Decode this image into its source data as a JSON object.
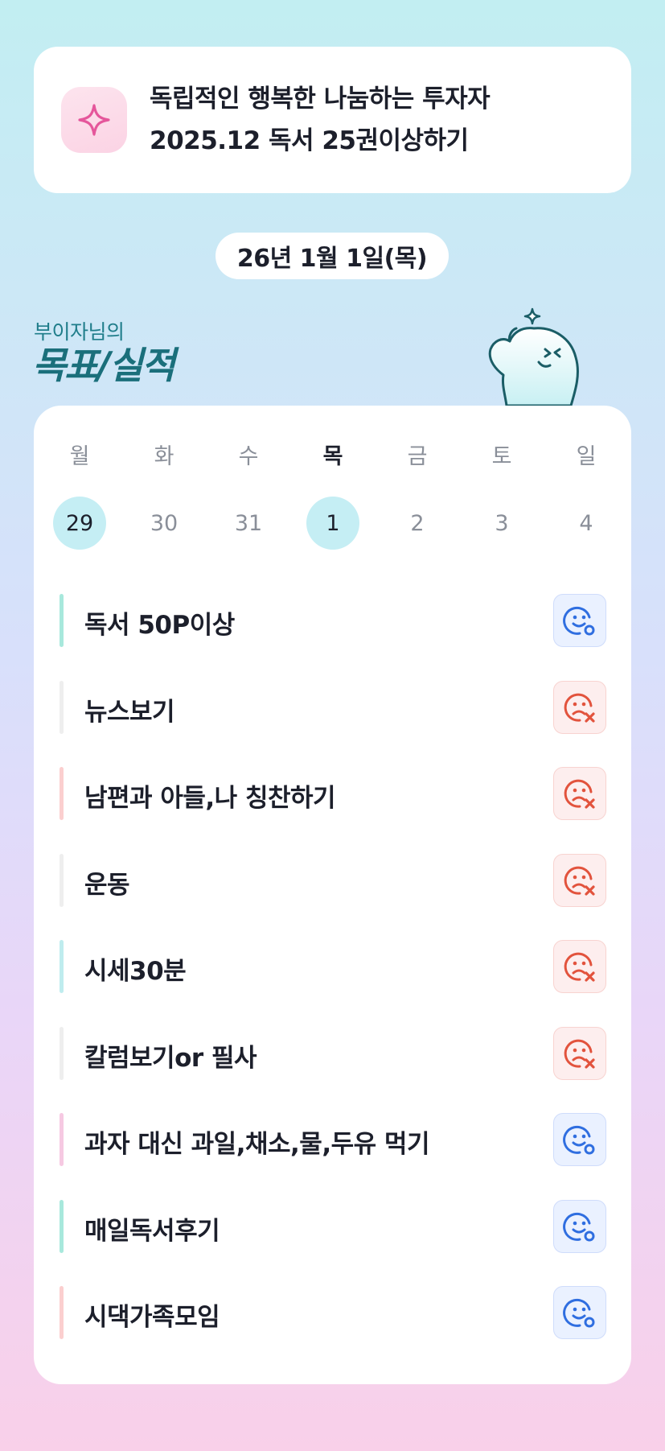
{
  "goal_card": {
    "line1": "독립적인 행복한 나눔하는 투자자",
    "line2": "2025.12 독서 25권이상하기",
    "icon": "sparkle-icon"
  },
  "date_label": "26년 1월 1일(목)",
  "section": {
    "owner": "부이자님의",
    "title": "목표/실적"
  },
  "week": [
    {
      "day": "월",
      "date": "29"
    },
    {
      "day": "화",
      "date": "30"
    },
    {
      "day": "수",
      "date": "31"
    },
    {
      "day": "목",
      "date": "1"
    },
    {
      "day": "금",
      "date": "2"
    },
    {
      "day": "토",
      "date": "3"
    },
    {
      "day": "일",
      "date": "4"
    }
  ],
  "goals": [
    {
      "label": "독서 50P이상",
      "status": "achieved",
      "bar_color": "#a8e8dc"
    },
    {
      "label": "뉴스보기",
      "status": "missed",
      "bar_color": "#eeeeee"
    },
    {
      "label": "남편과 아들,나 칭찬하기",
      "status": "missed",
      "bar_color": "#fbcfcf"
    },
    {
      "label": "운동",
      "status": "missed",
      "bar_color": "#eeeeee"
    },
    {
      "label": "시세30분",
      "status": "missed",
      "bar_color": "#bfecee"
    },
    {
      "label": "칼럼보기or 필사",
      "status": "missed",
      "bar_color": "#eeeeee"
    },
    {
      "label": "과자 대신 과일,채소,물,두유 먹기",
      "status": "achieved",
      "bar_color": "#f6c9e2"
    },
    {
      "label": "매일독서후기",
      "status": "achieved",
      "bar_color": "#a8e8dc"
    },
    {
      "label": "시댁가족모임",
      "status": "achieved",
      "bar_color": "#fbcfcf"
    }
  ],
  "colors": {
    "achieved": "#2f6ee0",
    "missed": "#e2533d",
    "accent_teal": "#1a6f7b"
  }
}
